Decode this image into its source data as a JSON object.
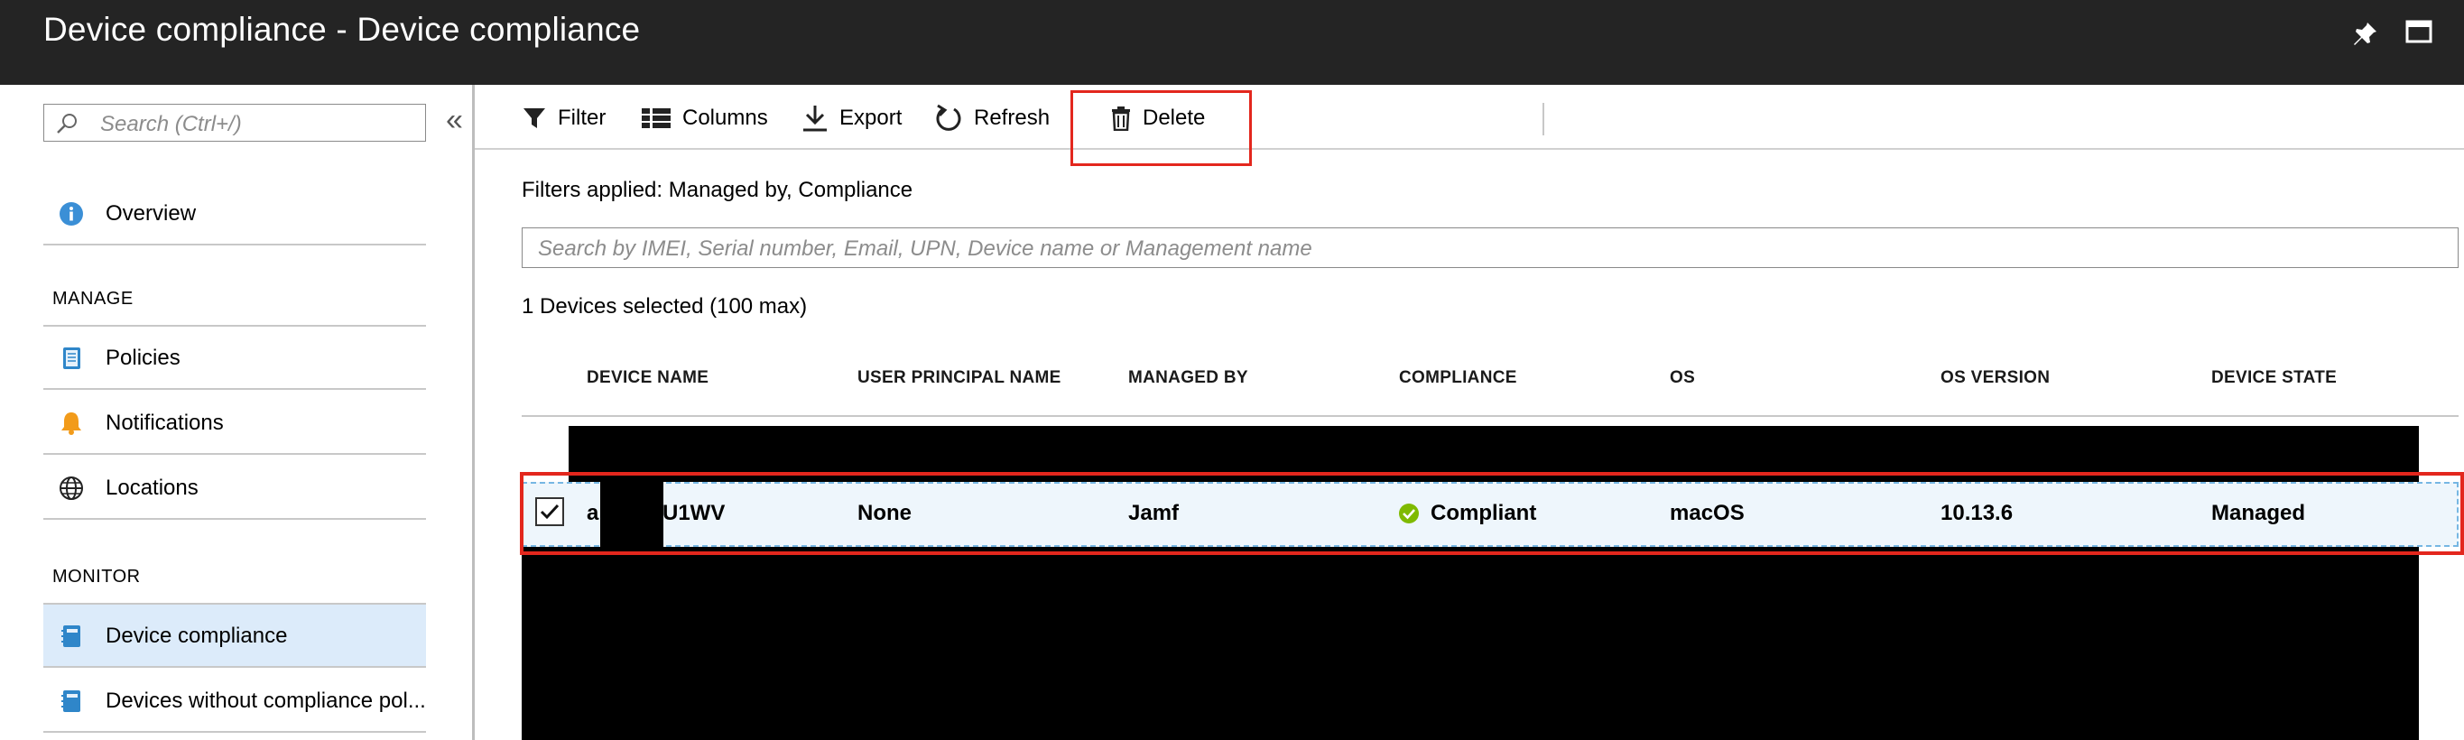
{
  "window": {
    "title": "Device compliance - Device compliance",
    "pin_icon": "pin-icon",
    "maximize_icon": "maximize-icon"
  },
  "sidebar": {
    "search_placeholder": "Search (Ctrl+/)",
    "collapse_glyph": "«",
    "overview": "Overview",
    "manage_header": "MANAGE",
    "manage_items": [
      "Policies",
      "Notifications",
      "Locations"
    ],
    "monitor_header": "MONITOR",
    "monitor_items": [
      "Device compliance",
      "Devices without compliance pol..."
    ]
  },
  "toolbar": {
    "filter": "Filter",
    "columns": "Columns",
    "export": "Export",
    "refresh": "Refresh",
    "delete": "Delete"
  },
  "filters_applied": "Filters applied: Managed by, Compliance",
  "search_placeholder": "Search by IMEI, Serial number, Email, UPN, Device name or Management name",
  "selection_status": "1 Devices selected (100 max)",
  "table": {
    "columns": [
      "DEVICE NAME",
      "USER PRINCIPAL NAME",
      "MANAGED BY",
      "COMPLIANCE",
      "OS",
      "OS VERSION",
      "DEVICE STATE"
    ],
    "selected_row": {
      "device_name_prefix": "ar",
      "device_name_suffix": "U1WV",
      "user_principal_name": "None",
      "managed_by": "Jamf",
      "compliance": "Compliant",
      "os": "macOS",
      "os_version": "10.13.6",
      "device_state": "Managed"
    }
  },
  "colors": {
    "titlebar": "#242424",
    "highlight_red": "#e3271d",
    "active_nav": "#dcebfa",
    "compliant_green": "#7fba00"
  }
}
